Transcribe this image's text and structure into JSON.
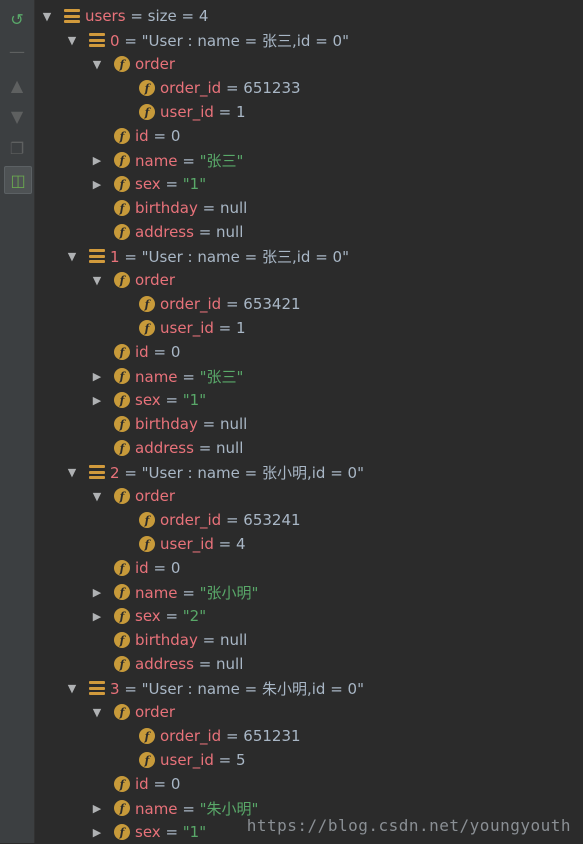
{
  "toolbar": [
    "restore-icon",
    "minus-icon",
    "arrow-up-icon",
    "arrow-down-icon",
    "copy-icon",
    "watch-icon"
  ],
  "tree": [
    {
      "depth": 0,
      "toggle": "down",
      "icon": "list",
      "name": "users",
      "eq": " =  ",
      "value": "size = 4",
      "vtype": "v"
    },
    {
      "depth": 1,
      "toggle": "down",
      "icon": "list",
      "name": "0",
      "eq": " = ",
      "value": "\"User : name = 张三,id = 0\"",
      "vtype": "v"
    },
    {
      "depth": 2,
      "toggle": "down",
      "icon": "f",
      "name": "order",
      "eq": "",
      "value": "",
      "vtype": "v"
    },
    {
      "depth": 3,
      "toggle": "",
      "icon": "f",
      "name": "order_id",
      "eq": " = ",
      "value": "651233",
      "vtype": "v"
    },
    {
      "depth": 3,
      "toggle": "",
      "icon": "f",
      "name": "user_id",
      "eq": " = ",
      "value": "1",
      "vtype": "v"
    },
    {
      "depth": 2,
      "toggle": "",
      "icon": "f",
      "name": "id",
      "eq": " = ",
      "value": "0",
      "vtype": "v"
    },
    {
      "depth": 2,
      "toggle": "right",
      "icon": "f",
      "name": "name",
      "eq": " = ",
      "value": "\"张三\"",
      "vtype": "s"
    },
    {
      "depth": 2,
      "toggle": "right",
      "icon": "f",
      "name": "sex",
      "eq": " = ",
      "value": "\"1\"",
      "vtype": "s"
    },
    {
      "depth": 2,
      "toggle": "",
      "icon": "f",
      "name": "birthday",
      "eq": " = ",
      "value": "null",
      "vtype": "v"
    },
    {
      "depth": 2,
      "toggle": "",
      "icon": "f",
      "name": "address",
      "eq": " = ",
      "value": "null",
      "vtype": "v"
    },
    {
      "depth": 1,
      "toggle": "down",
      "icon": "list",
      "name": "1",
      "eq": " = ",
      "value": "\"User : name = 张三,id = 0\"",
      "vtype": "v"
    },
    {
      "depth": 2,
      "toggle": "down",
      "icon": "f",
      "name": "order",
      "eq": "",
      "value": "",
      "vtype": "v"
    },
    {
      "depth": 3,
      "toggle": "",
      "icon": "f",
      "name": "order_id",
      "eq": " = ",
      "value": "653421",
      "vtype": "v"
    },
    {
      "depth": 3,
      "toggle": "",
      "icon": "f",
      "name": "user_id",
      "eq": " = ",
      "value": "1",
      "vtype": "v"
    },
    {
      "depth": 2,
      "toggle": "",
      "icon": "f",
      "name": "id",
      "eq": " = ",
      "value": "0",
      "vtype": "v"
    },
    {
      "depth": 2,
      "toggle": "right",
      "icon": "f",
      "name": "name",
      "eq": " = ",
      "value": "\"张三\"",
      "vtype": "s"
    },
    {
      "depth": 2,
      "toggle": "right",
      "icon": "f",
      "name": "sex",
      "eq": " = ",
      "value": "\"1\"",
      "vtype": "s"
    },
    {
      "depth": 2,
      "toggle": "",
      "icon": "f",
      "name": "birthday",
      "eq": " = ",
      "value": "null",
      "vtype": "v"
    },
    {
      "depth": 2,
      "toggle": "",
      "icon": "f",
      "name": "address",
      "eq": " = ",
      "value": "null",
      "vtype": "v"
    },
    {
      "depth": 1,
      "toggle": "down",
      "icon": "list",
      "name": "2",
      "eq": " = ",
      "value": "\"User : name = 张小明,id = 0\"",
      "vtype": "v"
    },
    {
      "depth": 2,
      "toggle": "down",
      "icon": "f",
      "name": "order",
      "eq": "",
      "value": "",
      "vtype": "v"
    },
    {
      "depth": 3,
      "toggle": "",
      "icon": "f",
      "name": "order_id",
      "eq": " = ",
      "value": "653241",
      "vtype": "v"
    },
    {
      "depth": 3,
      "toggle": "",
      "icon": "f",
      "name": "user_id",
      "eq": " = ",
      "value": "4",
      "vtype": "v"
    },
    {
      "depth": 2,
      "toggle": "",
      "icon": "f",
      "name": "id",
      "eq": " = ",
      "value": "0",
      "vtype": "v"
    },
    {
      "depth": 2,
      "toggle": "right",
      "icon": "f",
      "name": "name",
      "eq": " = ",
      "value": "\"张小明\"",
      "vtype": "s"
    },
    {
      "depth": 2,
      "toggle": "right",
      "icon": "f",
      "name": "sex",
      "eq": " = ",
      "value": "\"2\"",
      "vtype": "s"
    },
    {
      "depth": 2,
      "toggle": "",
      "icon": "f",
      "name": "birthday",
      "eq": " = ",
      "value": "null",
      "vtype": "v"
    },
    {
      "depth": 2,
      "toggle": "",
      "icon": "f",
      "name": "address",
      "eq": " = ",
      "value": "null",
      "vtype": "v"
    },
    {
      "depth": 1,
      "toggle": "down",
      "icon": "list",
      "name": "3",
      "eq": " = ",
      "value": "\"User : name = 朱小明,id = 0\"",
      "vtype": "v"
    },
    {
      "depth": 2,
      "toggle": "down",
      "icon": "f",
      "name": "order",
      "eq": "",
      "value": "",
      "vtype": "v"
    },
    {
      "depth": 3,
      "toggle": "",
      "icon": "f",
      "name": "order_id",
      "eq": " = ",
      "value": "651231",
      "vtype": "v"
    },
    {
      "depth": 3,
      "toggle": "",
      "icon": "f",
      "name": "user_id",
      "eq": " = ",
      "value": "5",
      "vtype": "v"
    },
    {
      "depth": 2,
      "toggle": "",
      "icon": "f",
      "name": "id",
      "eq": " = ",
      "value": "0",
      "vtype": "v"
    },
    {
      "depth": 2,
      "toggle": "right",
      "icon": "f",
      "name": "name",
      "eq": " = ",
      "value": "\"朱小明\"",
      "vtype": "s"
    },
    {
      "depth": 2,
      "toggle": "right",
      "icon": "f",
      "name": "sex",
      "eq": " = ",
      "value": "\"1\"",
      "vtype": "s"
    }
  ],
  "watermark": "https://blog.csdn.net/youngyouth",
  "colors": {
    "field_name": "#e8727a",
    "string_value": "#59a869",
    "field_icon": "#c79a3a"
  }
}
